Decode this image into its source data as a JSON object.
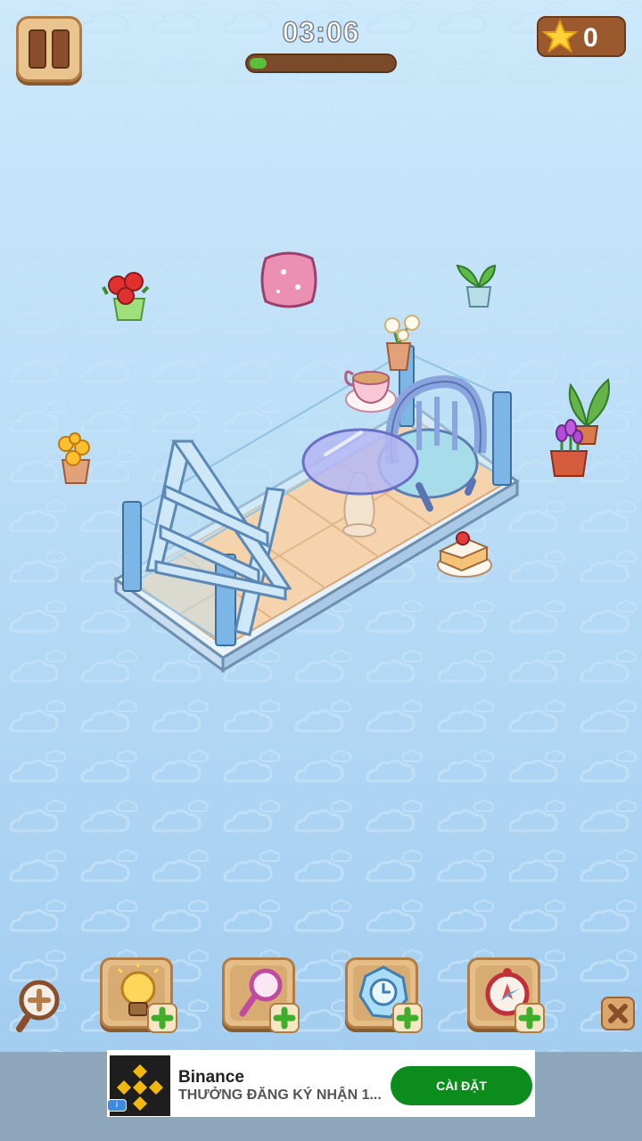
{
  "hud": {
    "timer": "03:06",
    "progress_fraction": 0.12,
    "stars": "0"
  },
  "colors": {
    "sky_top": "#cde9fb",
    "wood": "#e4bd87",
    "progress_green": "#5bbf3a",
    "cta_green": "#0b8c1d"
  },
  "scene_items": [
    {
      "name": "red-flower-pot",
      "icon": "red-flowers-icon"
    },
    {
      "name": "pink-cushion",
      "icon": "cushion-icon"
    },
    {
      "name": "green-plant",
      "icon": "potted-plant-icon"
    },
    {
      "name": "white-flower-pot",
      "icon": "white-flowers-icon"
    },
    {
      "name": "teacup",
      "icon": "teacup-icon"
    },
    {
      "name": "yellow-flower-pot",
      "icon": "yellow-flowers-icon"
    },
    {
      "name": "tall-leaf-plant",
      "icon": "leaf-plant-icon"
    },
    {
      "name": "purple-tulips",
      "icon": "tulip-icon"
    },
    {
      "name": "cake-slice",
      "icon": "cake-icon"
    }
  ],
  "toolbar": {
    "tools": [
      {
        "name": "hint-tool",
        "icon": "lightbulb-icon"
      },
      {
        "name": "magnify-tool",
        "icon": "magnifier-icon"
      },
      {
        "name": "freeze-tool",
        "icon": "frozen-clock-icon"
      },
      {
        "name": "compass-tool",
        "icon": "compass-icon"
      }
    ]
  },
  "ad": {
    "title": "Binance",
    "subtitle": "THƯỞNG ĐĂNG KÝ NHẬN 1...",
    "cta": "CÀI ĐẶT",
    "info": "i"
  }
}
